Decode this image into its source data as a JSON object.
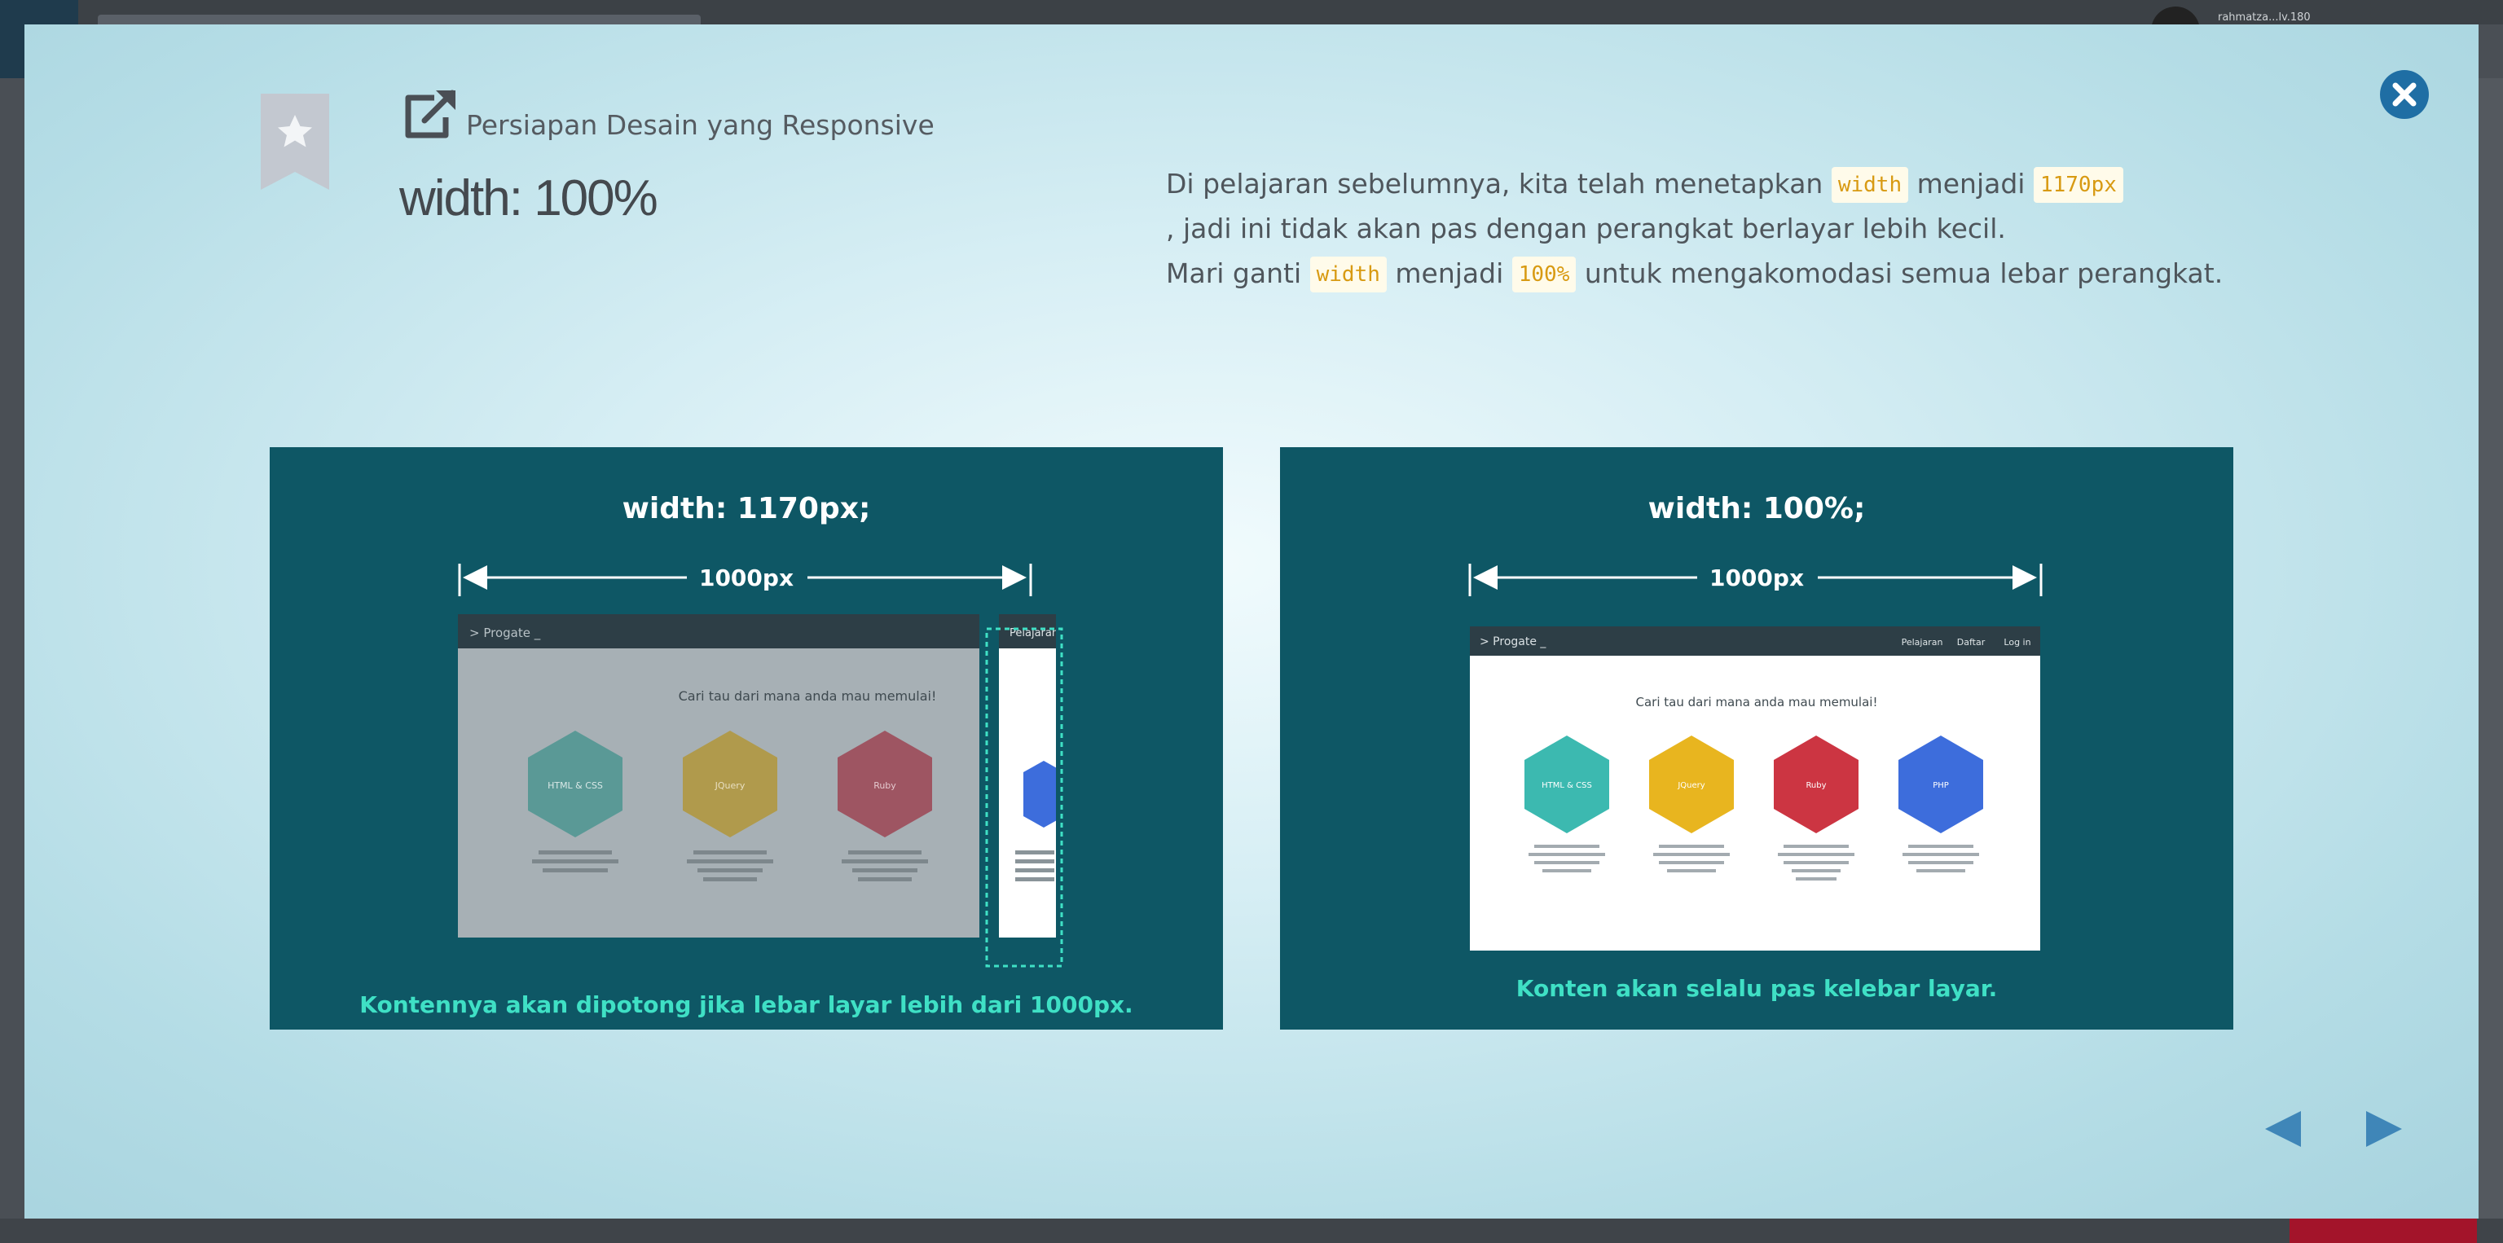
{
  "background": {
    "user_label": "rahmatza...lv.180"
  },
  "modal": {
    "lesson_name": "Persiapan Desain yang Responsive",
    "slide_title": "width: 100%",
    "description": {
      "line1_a": "Di pelajaran sebelumnya, kita telah menetapkan ",
      "code_width_1": "width",
      "line1_b": " menjadi ",
      "code_1170": "1170px",
      "line2": ", jadi ini tidak akan pas dengan perangkat berlayar lebih kecil.",
      "line3_a": "Mari ganti ",
      "code_width_2": "width",
      "line3_b": " menjadi ",
      "code_100": "100%",
      "line3_c": " untuk mengakomodasi semua lebar perangkat."
    },
    "icons": {
      "bookmark": "bookmark-star-icon",
      "share": "external-link-icon",
      "close": "close-icon",
      "prev": "triangle-left-icon",
      "next": "triangle-right-icon"
    }
  },
  "left_panel": {
    "title": "width: 1170px;",
    "dimension": "1000px",
    "logo": "> Progate _",
    "nav_item": "Pelajaran",
    "heading": "Cari tau dari mana anda mau memulai!",
    "hex_labels": [
      "HTML & CSS",
      "JQuery",
      "Ruby"
    ],
    "caption": "Kontennya akan dipotong jika lebar layar lebih dari 1000px."
  },
  "right_panel": {
    "title": "width: 100%;",
    "dimension": "1000px",
    "logo": "> Progate _",
    "nav_items": [
      "Pelajaran",
      "Daftar",
      "Log in"
    ],
    "heading": "Cari tau dari mana anda mau memulai!",
    "hex_labels": [
      "HTML & CSS",
      "JQuery",
      "Ruby",
      "PHP"
    ],
    "caption": "Konten akan selalu pas kelebar layar."
  },
  "colors": {
    "panel_bg": "#0e5765",
    "caption": "#3fe0c5",
    "code_text": "#d89a12",
    "hex_teal": "#3cb9b0",
    "hex_yellow": "#e8b51f",
    "hex_red": "#cc3542",
    "hex_blue": "#3d6ddc"
  }
}
